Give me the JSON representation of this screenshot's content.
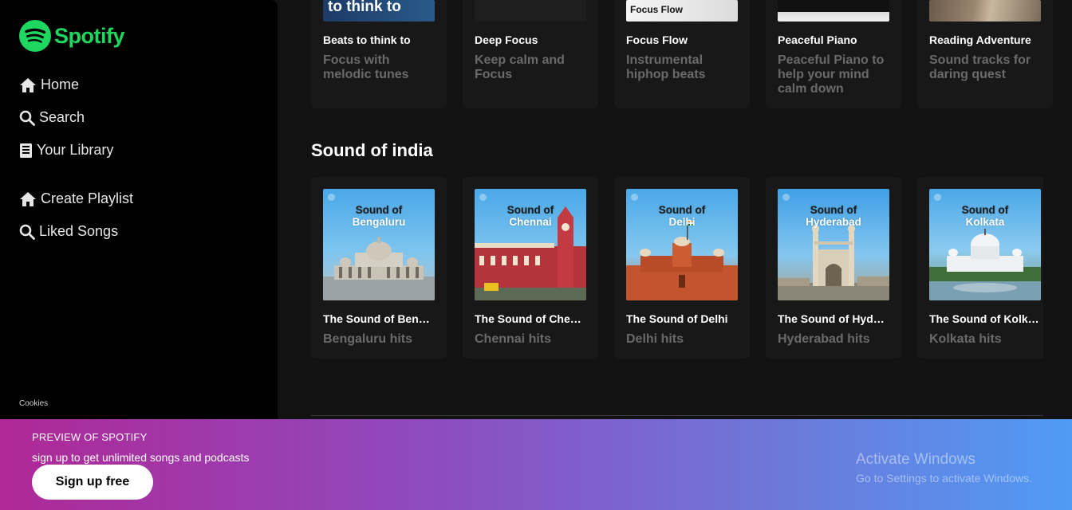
{
  "app": {
    "brand": "Spotify",
    "accent": "#1ed760"
  },
  "sidebar": {
    "nav": [
      {
        "label": "Home",
        "icon": "home-icon"
      },
      {
        "label": "Search",
        "icon": "search-icon"
      },
      {
        "label": "Your Library",
        "icon": "library-icon"
      }
    ],
    "actions": [
      {
        "label": "Create Playlist",
        "icon": "home-icon"
      },
      {
        "label": "Liked Songs",
        "icon": "search-icon"
      }
    ],
    "cookies": "Cookies"
  },
  "focus": {
    "cards": [
      {
        "title": "Beats to think to",
        "desc": "Focus with melodic tunes",
        "thumb_text": "to think to"
      },
      {
        "title": "Deep Focus",
        "desc": "Keep calm and Focus"
      },
      {
        "title": "Focus Flow",
        "desc": "Instrumental hiphop beats",
        "thumb_text": "Focus Flow"
      },
      {
        "title": "Peaceful Piano",
        "desc": "Peaceful Piano to help your mind calm down"
      },
      {
        "title": "Reading Adventure",
        "desc": "Sound tracks for daring quest"
      }
    ]
  },
  "india": {
    "title": "Sound of india",
    "cards": [
      {
        "title": "The Sound of Ben…",
        "desc": "Bengaluru hits",
        "thumb_line1": "Sound of",
        "thumb_line2": "Bengaluru"
      },
      {
        "title": "The Sound of Che…",
        "desc": "Chennai hits",
        "thumb_line1": "Sound of",
        "thumb_line2": "Chennai"
      },
      {
        "title": "The Sound of Delhi",
        "desc": "Delhi hits",
        "thumb_line1": "Sound of",
        "thumb_line2": "Delhi"
      },
      {
        "title": "The Sound of Hyd…",
        "desc": "Hyderabad hits",
        "thumb_line1": "Sound of",
        "thumb_line2": "Hyderabad"
      },
      {
        "title": "The Sound of Kolk…",
        "desc": "Kolkata hits",
        "thumb_line1": "Sound of",
        "thumb_line2": "Kolkata"
      }
    ]
  },
  "banner": {
    "preview": "PREVIEW OF SPOTIFY",
    "subtitle": "sign up to get unlimited songs and podcasts",
    "signup": "Sign up free"
  },
  "watermark": {
    "line1": "Activate Windows",
    "line2": "Go to Settings to activate Windows."
  }
}
